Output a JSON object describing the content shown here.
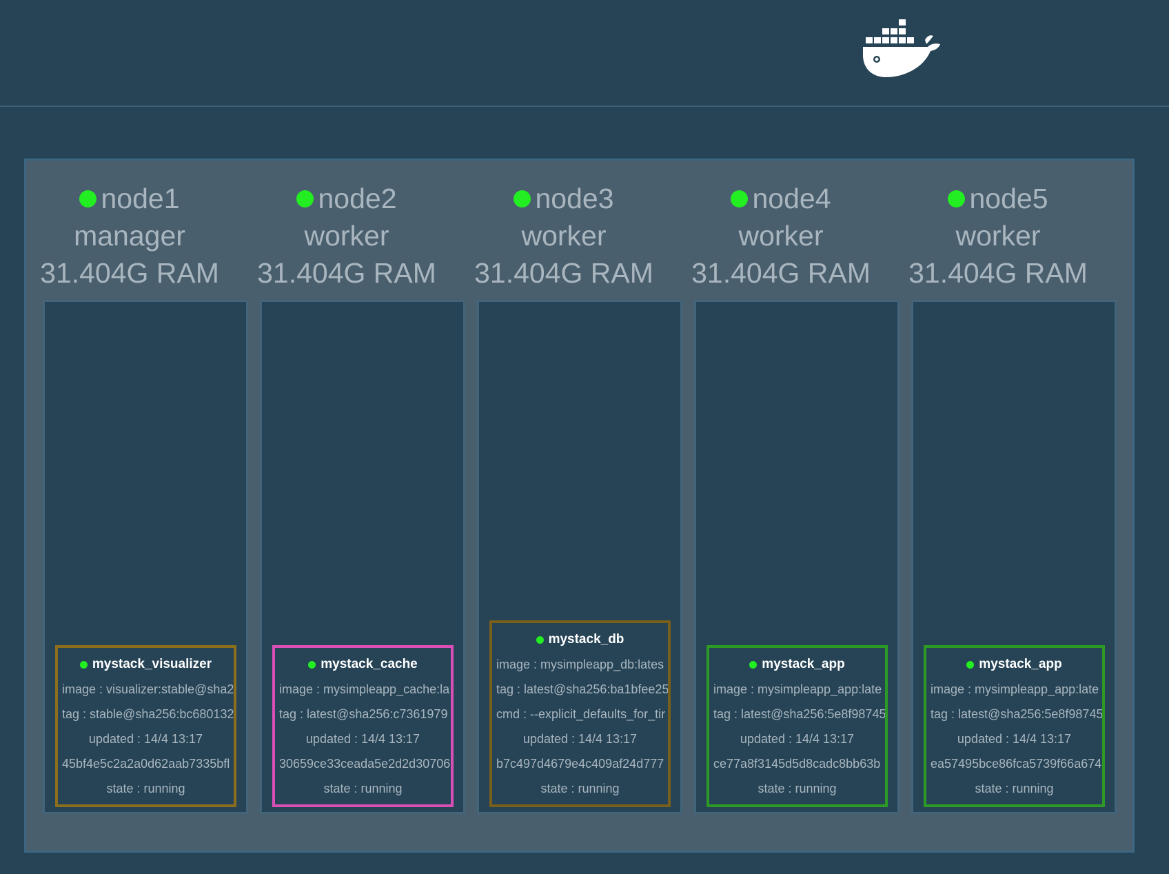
{
  "logo": {
    "icon": "docker-whale-icon"
  },
  "nodes": [
    {
      "name": "node1",
      "role": "manager",
      "ram": "31.404G RAM",
      "status_color": "#22ee22",
      "task": {
        "service": "mystack_visualizer",
        "border_color": "#8b6f1c",
        "image": "image : visualizer:stable@sha2",
        "tag": "tag : stable@sha256:bc680132",
        "cmd": "",
        "updated": "updated : 14/4 13:17",
        "id": "45bf4e5c2a2a0d62aab7335bfl",
        "state": "state : running"
      }
    },
    {
      "name": "node2",
      "role": "worker",
      "ram": "31.404G RAM",
      "status_color": "#22ee22",
      "task": {
        "service": "mystack_cache",
        "border_color": "#d94fb6",
        "image": "image : mysimpleapp_cache:la",
        "tag": "tag : latest@sha256:c7361979",
        "cmd": "",
        "updated": "updated : 14/4 13:17",
        "id": "30659ce33ceada5e2d2d30706",
        "state": "state : running"
      }
    },
    {
      "name": "node3",
      "role": "worker",
      "ram": "31.404G RAM",
      "status_color": "#22ee22",
      "task": {
        "service": "mystack_db",
        "border_color": "#7a5f1a",
        "image": "image : mysimpleapp_db:lates",
        "tag": "tag : latest@sha256:ba1bfee25",
        "cmd": "cmd : --explicit_defaults_for_tir",
        "updated": "updated : 14/4 13:17",
        "id": "b7c497d4679e4c409af24d777",
        "state": "state : running"
      }
    },
    {
      "name": "node4",
      "role": "worker",
      "ram": "31.404G RAM",
      "status_color": "#22ee22",
      "task": {
        "service": "mystack_app",
        "border_color": "#2c9a25",
        "image": "image : mysimpleapp_app:late",
        "tag": "tag : latest@sha256:5e8f98745",
        "cmd": "",
        "updated": "updated : 14/4 13:17",
        "id": "ce77a8f3145d5d8cadc8bb63b",
        "state": "state : running"
      }
    },
    {
      "name": "node5",
      "role": "worker",
      "ram": "31.404G RAM",
      "status_color": "#22ee22",
      "task": {
        "service": "mystack_app",
        "border_color": "#2c9a25",
        "image": "image : mysimpleapp_app:late",
        "tag": "tag : latest@sha256:5e8f98745",
        "cmd": "",
        "updated": "updated : 14/4 13:17",
        "id": "ea57495bce86fca5739f66a674",
        "state": "state : running"
      }
    }
  ]
}
